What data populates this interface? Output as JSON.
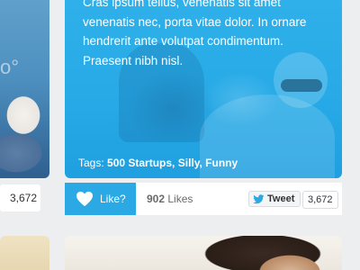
{
  "left_card": {
    "count": "3,672"
  },
  "main_card": {
    "body_text": "Cras ipsum tellus, venenatis sit amet venenatis nec, porta vitae dolor. In ornare hendrerit ante volutpat condimentum. Praesent nibh nisl.",
    "tags_label": "Tags:",
    "tags": "500 Startups, Silly, Funny"
  },
  "actions": {
    "like_label": "Like?",
    "likes_number": "902",
    "likes_word": "Likes",
    "tweet_label": "Tweet",
    "tweet_count": "3,672",
    "accent_color": "#2aa9e4"
  },
  "icons": {
    "like": "heart-icon",
    "tweet": "twitter-bird-icon"
  }
}
